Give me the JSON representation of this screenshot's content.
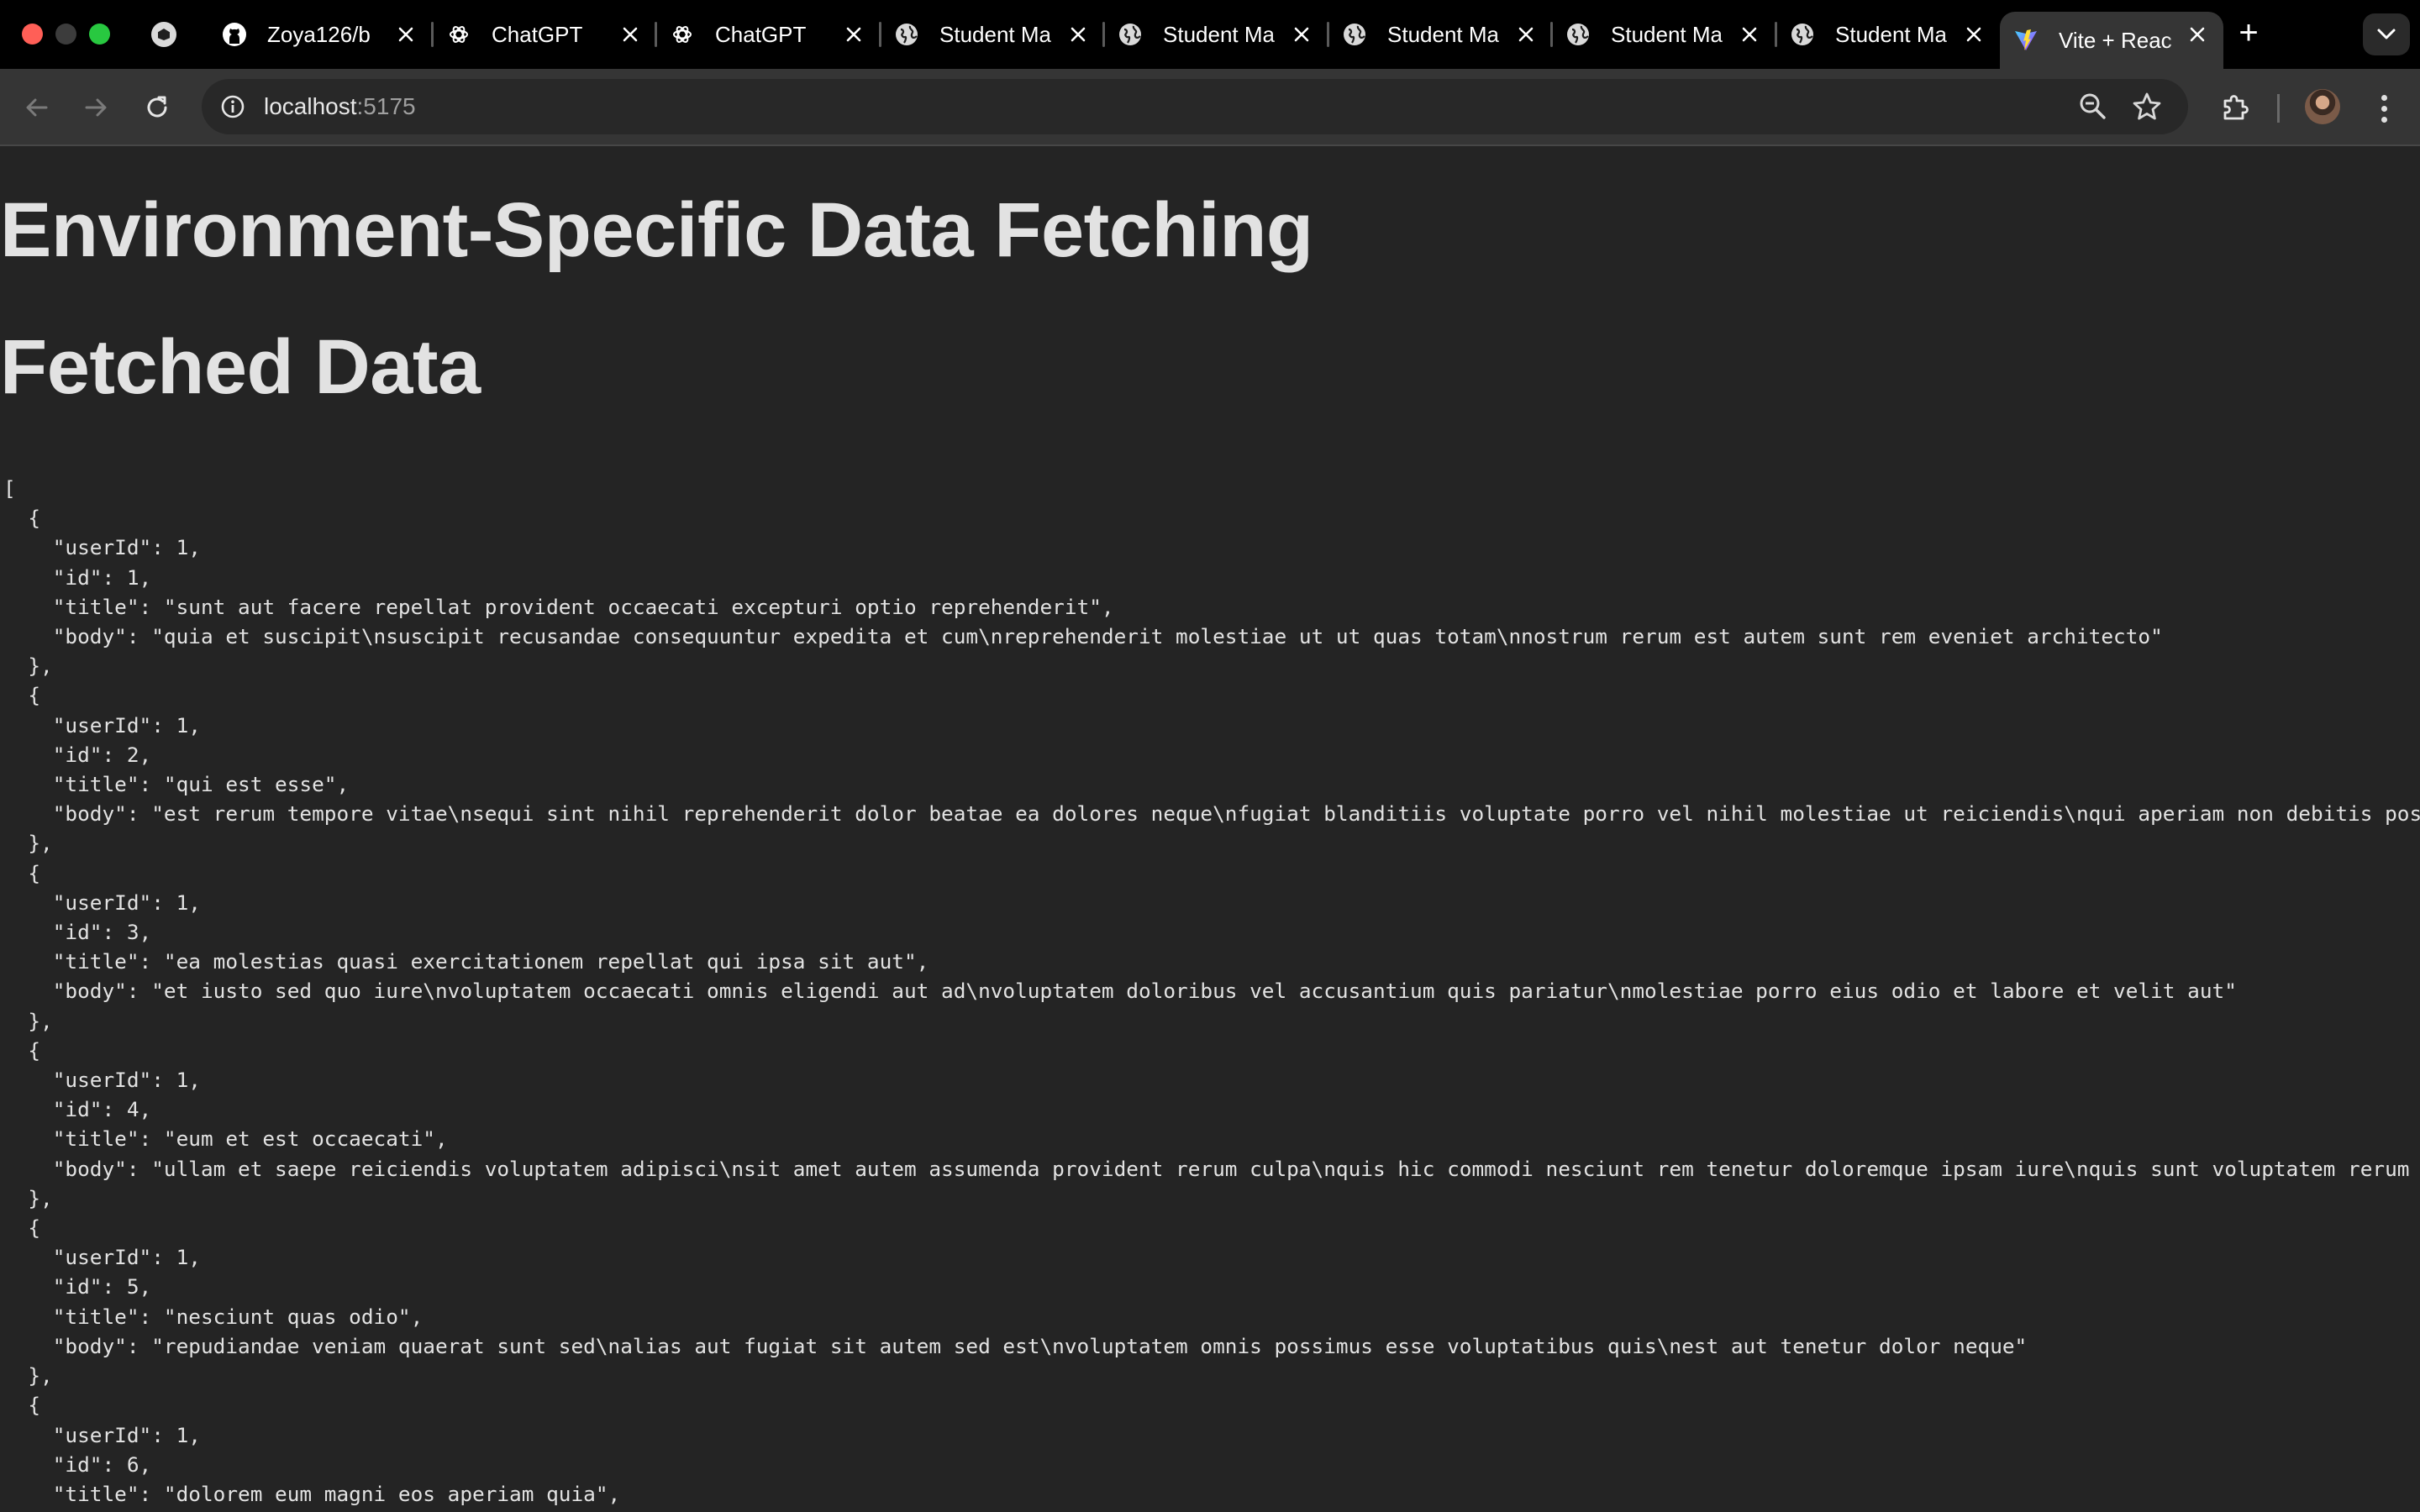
{
  "browser": {
    "tabs": [
      {
        "label": "Zoya126/b",
        "icon": "github-icon",
        "active": false
      },
      {
        "label": "ChatGPT",
        "icon": "chatgpt-icon",
        "active": false
      },
      {
        "label": "ChatGPT",
        "icon": "chatgpt-icon",
        "active": false
      },
      {
        "label": "Student Ma",
        "icon": "globe-icon",
        "active": false
      },
      {
        "label": "Student Ma",
        "icon": "globe-icon",
        "active": false
      },
      {
        "label": "Student Ma",
        "icon": "globe-icon",
        "active": false
      },
      {
        "label": "Student Ma",
        "icon": "globe-icon",
        "active": false
      },
      {
        "label": "Student Ma",
        "icon": "globe-icon",
        "active": false
      },
      {
        "label": "Vite + Reac",
        "icon": "vite-icon",
        "active": true
      }
    ],
    "new_tab_label": "+",
    "url_host": "localhost",
    "url_port": ":5175"
  },
  "page": {
    "heading": "Environment-Specific Data Fetching",
    "subheading": "Fetched Data"
  },
  "posts": [
    {
      "userId": 1,
      "id": 1,
      "title": "sunt aut facere repellat provident occaecati excepturi optio reprehenderit",
      "body": "quia et suscipit\\nsuscipit recusandae consequuntur expedita et cum\\nreprehenderit molestiae ut ut quas totam\\nnostrum rerum est autem sunt rem eveniet architecto"
    },
    {
      "userId": 1,
      "id": 2,
      "title": "qui est esse",
      "body": "est rerum tempore vitae\\nsequi sint nihil reprehenderit dolor beatae ea dolores neque\\nfugiat blanditiis voluptate porro vel nihil molestiae ut reiciendis\\nqui aperiam non debitis possimus qui"
    },
    {
      "userId": 1,
      "id": 3,
      "title": "ea molestias quasi exercitationem repellat qui ipsa sit aut",
      "body": "et iusto sed quo iure\\nvoluptatem occaecati omnis eligendi aut ad\\nvoluptatem doloribus vel accusantium quis pariatur\\nmolestiae porro eius odio et labore et velit aut"
    },
    {
      "userId": 1,
      "id": 4,
      "title": "eum et est occaecati",
      "body": "ullam et saepe reiciendis voluptatem adipisci\\nsit amet autem assumenda provident rerum culpa\\nquis hic commodi nesciunt rem tenetur doloremque ipsam iure\\nquis sunt voluptatem rerum illo veli"
    },
    {
      "userId": 1,
      "id": 5,
      "title": "nesciunt quas odio",
      "body": "repudiandae veniam quaerat sunt sed\\nalias aut fugiat sit autem sed est\\nvoluptatem omnis possimus esse voluptatibus quis\\nest aut tenetur dolor neque"
    },
    {
      "userId": 1,
      "id": 6,
      "title": "dolorem eum magni eos aperiam quia"
    }
  ]
}
